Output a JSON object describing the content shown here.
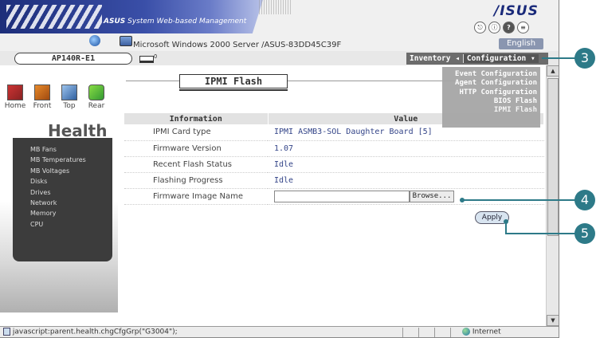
{
  "header": {
    "brand_prefix": "ASUS",
    "brand_rest": " System Web-based Management",
    "server_text": "Microsoft Windows 2000 Server /ASUS-83DD45C39F",
    "logo": "/ISUS",
    "language": "English",
    "tool_icons": [
      "logout-icon",
      "info-icon",
      "help-icon",
      "document-icon"
    ]
  },
  "menubar": {
    "host": "AP140R-E1",
    "count": "0",
    "inventory": "Inventory ◂",
    "configuration": "Configuration ▾"
  },
  "config_menu": {
    "items": [
      "Event Configuration",
      "Agent Configuration",
      "HTTP Configuration",
      "BIOS Flash",
      "IPMI Flash"
    ],
    "selected": "IPMI Flash"
  },
  "left_nav": {
    "views": [
      "Home",
      "Front",
      "Top",
      "Rear"
    ],
    "health_title": "Health",
    "health_items": [
      "MB Fans",
      "MB Temperatures",
      "MB Voltages",
      "Disks",
      "Drives",
      "Network",
      "Memory",
      "CPU"
    ]
  },
  "page": {
    "title": "IPMI Flash",
    "col_info": "Information",
    "col_value": "Value",
    "rows": [
      {
        "label": "IPMI Card type",
        "value": "IPMI ASMB3-SOL Daughter Board [5]"
      },
      {
        "label": "Firmware Version",
        "value": "1.07"
      },
      {
        "label": "Recent Flash Status",
        "value": "Idle"
      },
      {
        "label": "Flashing Progress",
        "value": "Idle"
      },
      {
        "label": "Firmware Image Name",
        "value": ""
      }
    ],
    "browse_label": "Browse...",
    "apply_label": "Apply"
  },
  "statusbar": {
    "text": "javascript:parent.health.chgCfgGrp(\"G3004\");",
    "zone": "Internet"
  },
  "callouts": [
    "3",
    "4",
    "5"
  ],
  "colors": {
    "callout": "#2d7a88",
    "brand_blue": "#1d2e7a",
    "nav_gray": "#6c6c6c"
  }
}
